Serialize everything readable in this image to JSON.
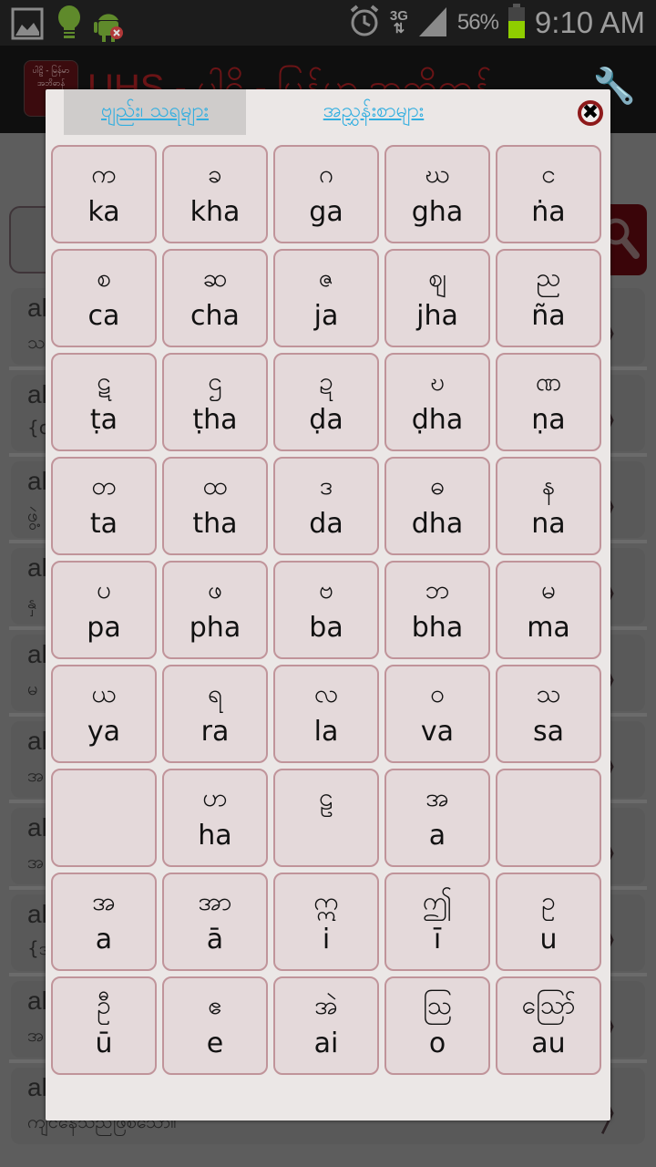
{
  "status_bar": {
    "left_icons": [
      "gallery-icon",
      "lightbulb-icon",
      "android-debug-icon"
    ],
    "network": "3G",
    "battery_percent": "56%",
    "battery_level": 0.56,
    "time": "9:10 AM"
  },
  "app_bar": {
    "logo_text": "ပါဠိ - မြန်မာ အဘိဓာန်",
    "title": "UHS - ပါဠိ - မြန်မာ အဘိဓာန်",
    "settings_icon": "wrench-icon"
  },
  "background_list": {
    "rows": [
      {
        "line1": "al",
        "line2": "သ"
      },
      {
        "line1": "al",
        "line2": "{c"
      },
      {
        "line1": "al",
        "line2": "ဖွဲ့"
      },
      {
        "line1": "al",
        "line2": "နှ"
      },
      {
        "line1": "al",
        "line2": "မ"
      },
      {
        "line1": "al",
        "line2": "အ"
      },
      {
        "line1": "al",
        "line2": "အ"
      },
      {
        "line1": "al",
        "line2": "{အ"
      },
      {
        "line1": "al",
        "line2": "အ"
      },
      {
        "line1": "al",
        "line2": "ကျင်နေသည်ဖြစ်သော။"
      }
    ]
  },
  "dialog": {
    "tabs": [
      {
        "label": "ဗျည်း၊ သရများ",
        "selected": true
      },
      {
        "label": "အညွှန်းစာများ",
        "selected": false
      }
    ],
    "close_label": "✖",
    "keys": [
      {
        "mm": "က",
        "lat": "ka"
      },
      {
        "mm": "ခ",
        "lat": "kha"
      },
      {
        "mm": "ဂ",
        "lat": "ga"
      },
      {
        "mm": "ဃ",
        "lat": "gha"
      },
      {
        "mm": "င",
        "lat": "ṅa"
      },
      {
        "mm": "စ",
        "lat": "ca"
      },
      {
        "mm": "ဆ",
        "lat": "cha"
      },
      {
        "mm": "ဇ",
        "lat": "ja"
      },
      {
        "mm": "ဈ",
        "lat": "jha"
      },
      {
        "mm": "ည",
        "lat": "ña"
      },
      {
        "mm": "ဋ",
        "lat": "ṭa"
      },
      {
        "mm": "ဌ",
        "lat": "ṭha"
      },
      {
        "mm": "ဍ",
        "lat": "ḍa"
      },
      {
        "mm": "ဎ",
        "lat": "ḍha"
      },
      {
        "mm": "ဏ",
        "lat": "ṇa"
      },
      {
        "mm": "တ",
        "lat": "ta"
      },
      {
        "mm": "ထ",
        "lat": "tha"
      },
      {
        "mm": "ဒ",
        "lat": "da"
      },
      {
        "mm": "ဓ",
        "lat": "dha"
      },
      {
        "mm": "န",
        "lat": "na"
      },
      {
        "mm": "ပ",
        "lat": "pa"
      },
      {
        "mm": "ဖ",
        "lat": "pha"
      },
      {
        "mm": "ဗ",
        "lat": "ba"
      },
      {
        "mm": "ဘ",
        "lat": "bha"
      },
      {
        "mm": "မ",
        "lat": "ma"
      },
      {
        "mm": "ယ",
        "lat": "ya"
      },
      {
        "mm": "ရ",
        "lat": "ra"
      },
      {
        "mm": "လ",
        "lat": "la"
      },
      {
        "mm": "ဝ",
        "lat": "va"
      },
      {
        "mm": "သ",
        "lat": "sa"
      },
      {
        "mm": "",
        "lat": ""
      },
      {
        "mm": "ဟ",
        "lat": "ha"
      },
      {
        "mm": "ဠ",
        "lat": ""
      },
      {
        "mm": "အ",
        "lat": "a"
      },
      {
        "mm": "",
        "lat": ""
      },
      {
        "mm": "အ",
        "lat": "a"
      },
      {
        "mm": "အာ",
        "lat": "ā"
      },
      {
        "mm": "ဣ",
        "lat": "i"
      },
      {
        "mm": "ဤ",
        "lat": "ī"
      },
      {
        "mm": "ဥ",
        "lat": "u"
      },
      {
        "mm": "ဦ",
        "lat": "ū"
      },
      {
        "mm": "ဧ",
        "lat": "e"
      },
      {
        "mm": "အဲ",
        "lat": "ai"
      },
      {
        "mm": "ဩ",
        "lat": "o"
      },
      {
        "mm": "ဪ",
        "lat": "au"
      }
    ]
  },
  "colors": {
    "tab_link": "#31aee0",
    "close_ring": "#8e1a1b",
    "key_bg": "#e4d9da",
    "key_border": "#c0949a",
    "app_title": "#6b1416",
    "battery": "#8fce00"
  }
}
